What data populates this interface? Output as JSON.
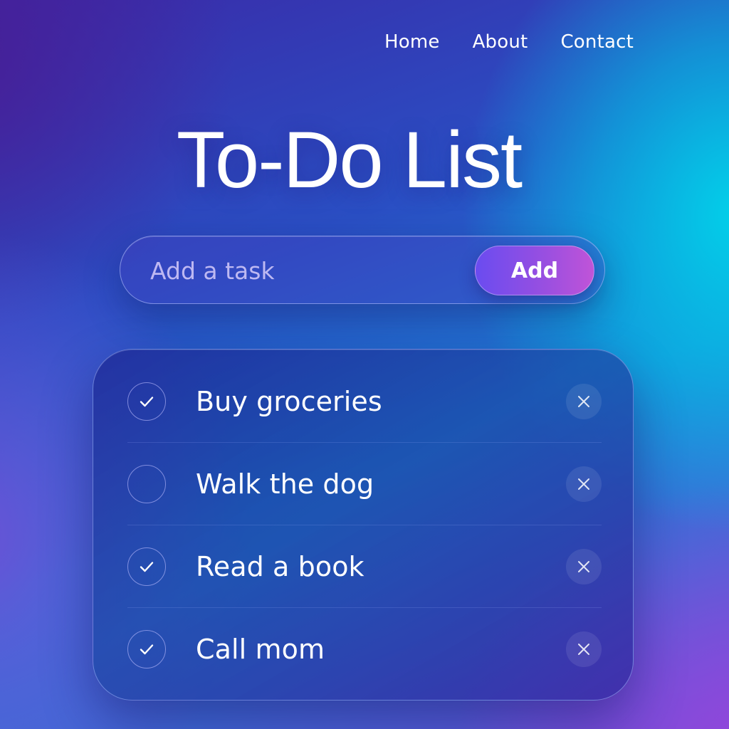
{
  "nav": {
    "items": [
      {
        "label": "Home"
      },
      {
        "label": "About"
      },
      {
        "label": "Contact"
      }
    ]
  },
  "header": {
    "title": "To-Do List"
  },
  "add_bar": {
    "placeholder": "Add a task",
    "value": "",
    "button_label": "Add"
  },
  "tasks": [
    {
      "text": "Buy groceries",
      "completed": true
    },
    {
      "text": "Walk the dog",
      "completed": false
    },
    {
      "text": "Read a book",
      "completed": true
    },
    {
      "text": "Call mom",
      "completed": true
    }
  ],
  "icons": {
    "check": "check-icon",
    "delete": "close-icon"
  },
  "colors": {
    "accent_start": "#6a4cf0",
    "accent_end": "#c054d8",
    "text": "#ffffff"
  }
}
